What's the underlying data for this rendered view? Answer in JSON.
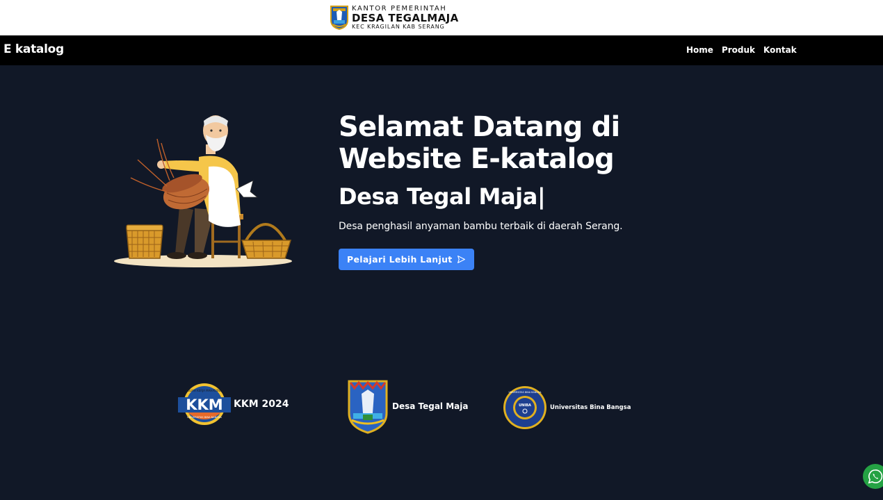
{
  "banner": {
    "line1": "KANTOR PEMERINTAH",
    "line2": "DESA TEGALMAJA",
    "line3": "KEC KRAGILAN KAB SERANG"
  },
  "navbar": {
    "brand": "E katalog",
    "links": [
      {
        "label": "Home"
      },
      {
        "label": "Produk"
      },
      {
        "label": "Kontak"
      }
    ]
  },
  "hero": {
    "title": "Selamat Datang di Website E-katalog",
    "subtitle": "Desa Tegal Maja|",
    "description": "Desa penghasil anyaman bambu terbaik di daerah Serang.",
    "cta_label": "Pelajari Lebih Lanjut",
    "cta_icon": "send-arrow-icon"
  },
  "kkm_badge": {
    "top": "KULIAH KERJA MAHASISWA",
    "main": "KKM",
    "bottom": "UNIVERSITAS BINA BANGSA"
  },
  "partners": [
    {
      "name": "KKM 2024",
      "icon": "kkm-logo-icon"
    },
    {
      "name": "Desa Tegal Maja",
      "icon": "village-crest-icon"
    },
    {
      "name": "Universitas Bina Bangsa",
      "icon": "university-seal-icon"
    }
  ],
  "university_seal": {
    "ring_text": "UNIVERSITAS BINA BANGSA",
    "center": "UNIBA"
  },
  "colors": {
    "background": "#111827",
    "navbar": "#000000",
    "accent": "#3b82f6",
    "whatsapp": "#25a244"
  },
  "floating": {
    "icon": "whatsapp-icon"
  }
}
